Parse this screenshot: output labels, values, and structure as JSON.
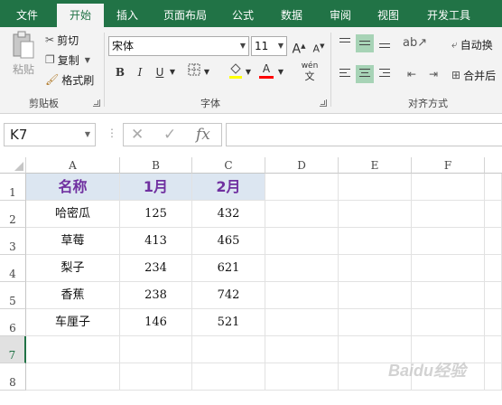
{
  "tabs": [
    "文件",
    "开始",
    "插入",
    "页面布局",
    "公式",
    "数据",
    "审阅",
    "视图",
    "开发工具"
  ],
  "clipboard": {
    "paste": "粘贴",
    "cut": "剪切",
    "copy": "复制",
    "format_painter": "格式刷",
    "group": "剪贴板"
  },
  "font": {
    "name": "宋体",
    "size": "11",
    "group": "字体",
    "grow": "A",
    "shrink": "A",
    "bold": "B",
    "italic": "I",
    "underline": "U",
    "phonetic": "wén",
    "fontcolor": "A"
  },
  "alignment": {
    "wrap": "自动换",
    "merge": "合并后",
    "group": "对齐方式"
  },
  "namebox": "K7",
  "formula": {
    "cancel": "✕",
    "enter": "✓",
    "fx": "fx",
    "value": ""
  },
  "columns": [
    "A",
    "B",
    "C",
    "D",
    "E",
    "F"
  ],
  "rows": [
    "1",
    "2",
    "3",
    "4",
    "5",
    "6",
    "7",
    "8"
  ],
  "table": {
    "header": [
      "名称",
      "1月",
      "2月"
    ],
    "rows": [
      [
        "哈密瓜",
        "125",
        "432"
      ],
      [
        "草莓",
        "413",
        "465"
      ],
      [
        "梨子",
        "234",
        "621"
      ],
      [
        "香蕉",
        "238",
        "742"
      ],
      [
        "车厘子",
        "146",
        "521"
      ]
    ]
  },
  "colors": {
    "accent": "#217346",
    "header_fill": "#dce6f1",
    "header_text": "#7030a0",
    "selected_row": "#217346"
  },
  "watermark": "Baidu经验"
}
